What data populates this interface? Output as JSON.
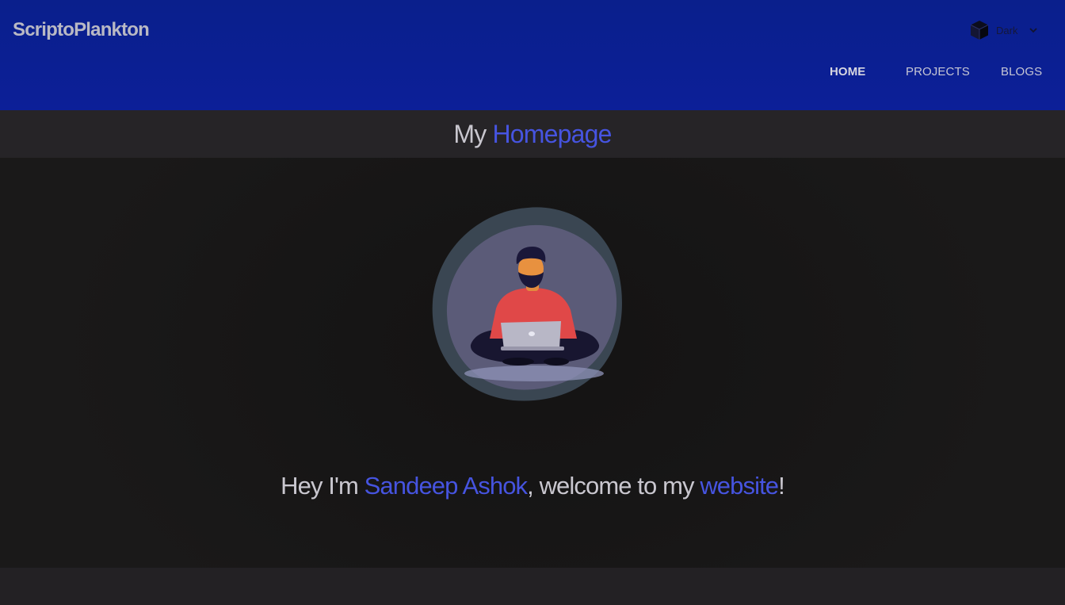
{
  "brand": "ScriptoPlankton",
  "theme_switch": {
    "icon": "cube-icon",
    "label": "Dark",
    "caret_icon": "chevron-down-icon"
  },
  "nav": {
    "items": [
      {
        "label": "HOME",
        "active": true
      },
      {
        "label": "PROJECTS",
        "active": false
      },
      {
        "label": "BLOGS",
        "active": false
      }
    ]
  },
  "title": {
    "prefix": "My",
    "highlight": "Homepage"
  },
  "hero": {
    "avatar_icon": "person-with-laptop-illustration",
    "greeting": {
      "part1": "Hey I'm ",
      "name": "Sandeep Ashok",
      "part2": ", welcome to my ",
      "link": "website",
      "part3": "!"
    }
  },
  "colors": {
    "header_bg": "#0b1f93",
    "accent": "#4654e0",
    "page_bg": "#232124",
    "hero_bg": "#161515"
  }
}
